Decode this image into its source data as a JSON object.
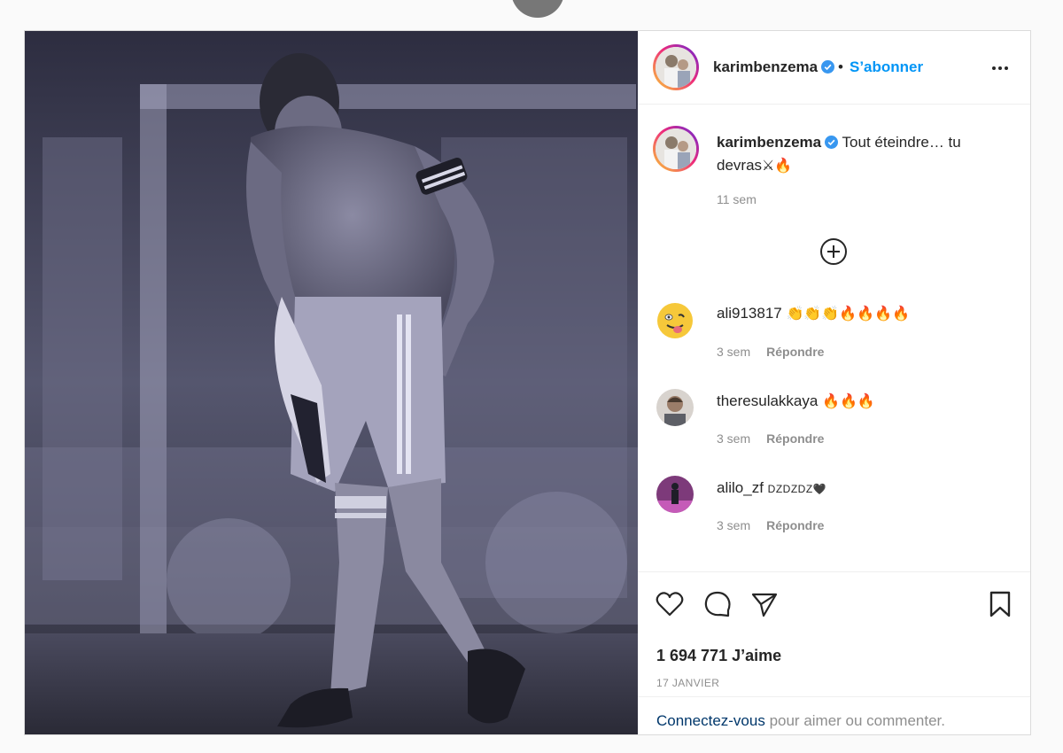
{
  "post": {
    "username": "karimbenzema",
    "follow_label": "S’abonner",
    "separator": "•",
    "caption": "Tout éteindre… tu devras",
    "caption_emoji": "⚔🔥",
    "caption_time": "11 sem",
    "likes": "1 694 771 J’aime",
    "date": "17 JANVIER",
    "login_link": "Connectez-vous",
    "login_rest": " pour aimer ou commenter."
  },
  "comments": [
    {
      "user": "ali913817",
      "text": "👏👏👏🔥🔥🔥🔥",
      "time": "3 sem",
      "reply": "Répondre"
    },
    {
      "user": "theresulakkaya",
      "text": "🔥🔥🔥",
      "time": "3 sem",
      "reply": "Répondre"
    },
    {
      "user": "alilo_zf",
      "text": "DZDZDZ🖤",
      "time": "3 sem",
      "reply": "Répondre"
    }
  ],
  "icons": {
    "verified": "verified-badge-icon",
    "more": "more-options-icon",
    "load_more": "plus-circle-icon",
    "like": "heart-icon",
    "comment": "comment-bubble-icon",
    "share": "paper-plane-icon",
    "save": "bookmark-icon"
  },
  "colors": {
    "accent": "#0095f6",
    "link": "#00376b",
    "muted": "#8e8e8e",
    "text": "#262626"
  }
}
